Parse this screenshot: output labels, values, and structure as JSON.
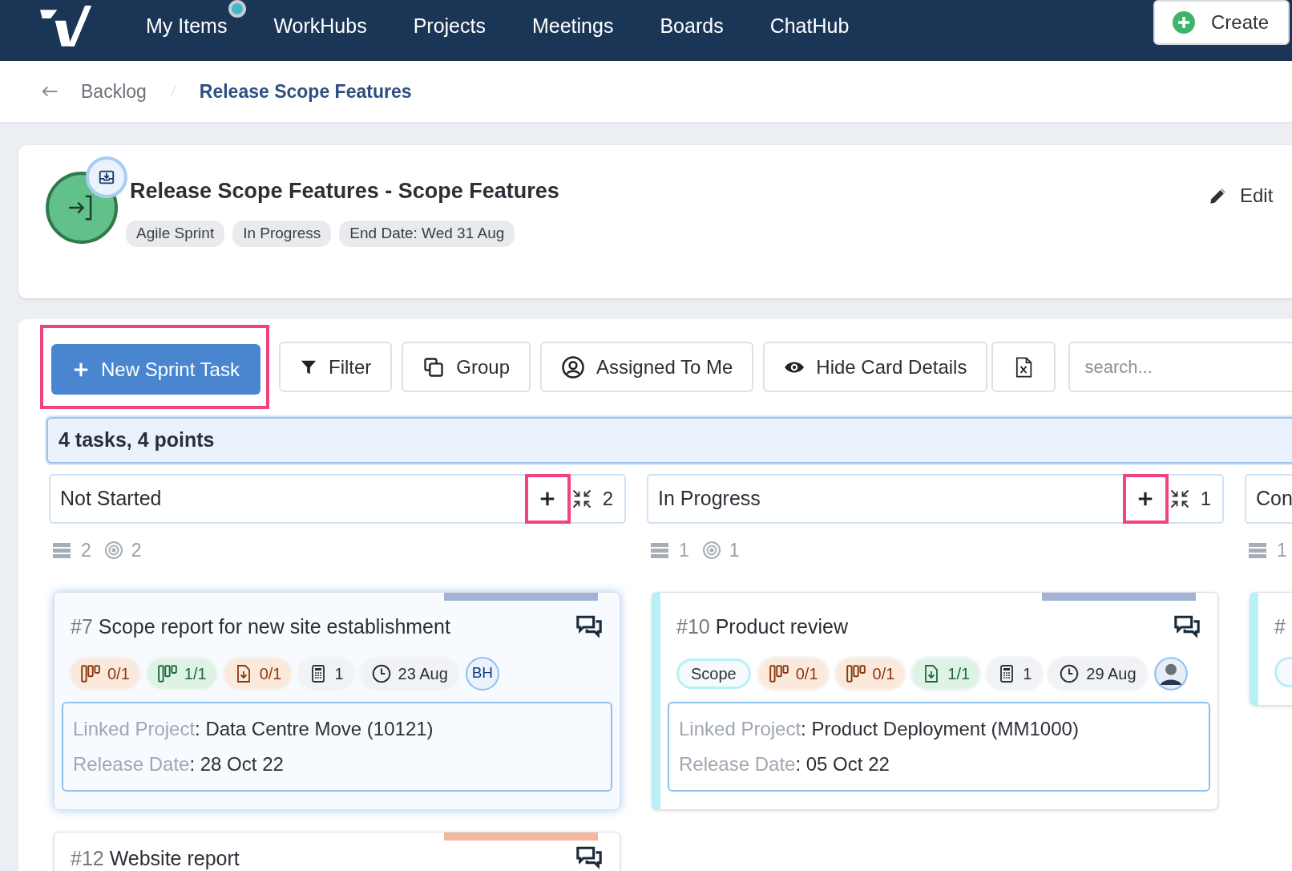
{
  "navbar": {
    "items": [
      {
        "label": "My Items",
        "notification": true
      },
      {
        "label": "WorkHubs",
        "notification": false
      },
      {
        "label": "Projects",
        "notification": false
      },
      {
        "label": "Meetings",
        "notification": false
      },
      {
        "label": "Boards",
        "notification": false
      },
      {
        "label": "ChatHub",
        "notification": false
      }
    ],
    "create_button": "Create"
  },
  "breadcrumb": {
    "items": [
      {
        "label": "Backlog",
        "current": false
      },
      {
        "label": "Release Scope Features",
        "current": true
      }
    ]
  },
  "header": {
    "title": "Release Scope Features - Scope Features",
    "tags": [
      "Agile Sprint",
      "In Progress",
      "End Date: Wed 31 Aug"
    ],
    "edit": "Edit"
  },
  "toolbar": {
    "buttons": [
      {
        "kind": "new",
        "label": "New Sprint Task",
        "highlighted": true
      },
      {
        "kind": "filter",
        "label": "Filter",
        "highlighted": false
      },
      {
        "kind": "group",
        "label": "Group",
        "highlighted": false
      },
      {
        "kind": "assigned",
        "label": "Assigned To Me",
        "highlighted": false
      },
      {
        "kind": "details",
        "label": "Hide Card Details",
        "highlighted": false
      },
      {
        "kind": "export",
        "highlighted": false
      }
    ],
    "search": {
      "placeholder": "search..."
    }
  },
  "summary": "4 tasks, 4 points",
  "columns": [
    {
      "title": "Not Started",
      "count": "2",
      "add_highlighted": true,
      "stats": [
        "2",
        "2"
      ],
      "cards": [
        {
          "number": "#7",
          "title": "Scope report for new site establishment",
          "color": "#a3b3d6",
          "selected": true,
          "left_bar": false,
          "chips": [
            {
              "kind": "subtasks",
              "color": "#fbeadb",
              "text": "0/1"
            },
            {
              "kind": "subtasks",
              "color": "#def3e6",
              "text": "1/1"
            },
            {
              "kind": "files",
              "color": "#fbeadb",
              "text": "0/1"
            },
            {
              "kind": "points",
              "color": "#f0f2f5",
              "text": "1"
            },
            {
              "kind": "due",
              "color": "#f0f2f5",
              "text": "23 Aug"
            }
          ],
          "assignee": {
            "kind": "initials",
            "text": "BH"
          },
          "details": [
            {
              "label": "Linked Project",
              "value": ": Data Centre Move (10121)"
            },
            {
              "label": "Release Date",
              "value": ": 28 Oct 22"
            }
          ]
        },
        {
          "number": "#12",
          "title": "Website report",
          "color": "#f2b9a0",
          "selected": false,
          "left_bar": false
        }
      ]
    },
    {
      "title": "In Progress",
      "count": "1",
      "add_highlighted": true,
      "stats": [
        "1",
        "1"
      ],
      "cards": [
        {
          "number": "#10",
          "title": "Product review",
          "color": "#a3b3d6",
          "selected": false,
          "left_bar": true,
          "chips": [
            {
              "kind": "tag",
              "text": "Scope"
            },
            {
              "kind": "subtasks",
              "color": "#fbeadb",
              "text": "0/1"
            },
            {
              "kind": "subtasks",
              "color": "#fbeadb",
              "text": "0/1"
            },
            {
              "kind": "files",
              "color": "#def3e6",
              "text": "1/1"
            },
            {
              "kind": "points",
              "color": "#f0f2f5",
              "text": "1"
            },
            {
              "kind": "due",
              "color": "#f0f2f5",
              "text": "29 Aug"
            }
          ],
          "assignee": {
            "kind": "photo"
          },
          "details": [
            {
              "label": "Linked Project",
              "value": ": Product Deployment (MM1000)"
            },
            {
              "label": "Release Date",
              "value": ": 05 Oct 22"
            }
          ]
        }
      ]
    },
    {
      "title": "Con",
      "stats": [
        "1"
      ],
      "cards": [
        {
          "number": "#",
          "selected": false,
          "left_bar": true,
          "chips": [
            {
              "kind": "tag"
            }
          ]
        }
      ]
    }
  ]
}
